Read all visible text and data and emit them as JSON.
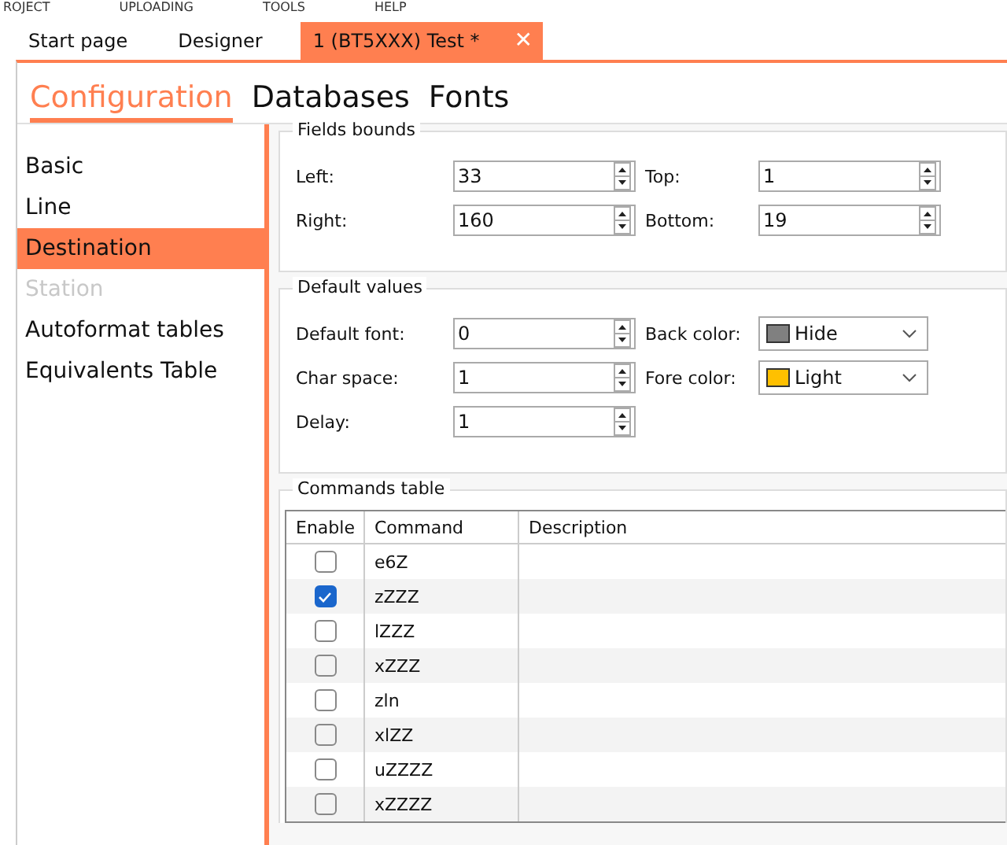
{
  "menu": [
    "ROJECT",
    "UPLOADING",
    "TOOLS",
    "HELP"
  ],
  "doc_tabs": [
    {
      "label": "Start page",
      "selected": false
    },
    {
      "label": "Designer",
      "selected": false
    },
    {
      "label": "1 (BT5XXX) Test *",
      "selected": true
    }
  ],
  "close_glyph": "✕",
  "sub_tabs": [
    {
      "label": "Configuration",
      "selected": true
    },
    {
      "label": "Databases",
      "selected": false
    },
    {
      "label": "Fonts",
      "selected": false
    }
  ],
  "sidebar": {
    "items": [
      {
        "label": "Basic",
        "selected": false,
        "disabled": false
      },
      {
        "label": "Line",
        "selected": false,
        "disabled": false
      },
      {
        "label": "Destination",
        "selected": true,
        "disabled": false
      },
      {
        "label": "Station",
        "selected": false,
        "disabled": true
      },
      {
        "label": "Autoformat tables",
        "selected": false,
        "disabled": false
      },
      {
        "label": "Equivalents Table",
        "selected": false,
        "disabled": false
      }
    ]
  },
  "fields_bounds": {
    "title": "Fields bounds",
    "rows": [
      [
        {
          "kind": "spin",
          "label": "Left:",
          "value": "33"
        },
        {
          "kind": "spin",
          "label": "Top:",
          "value": "1"
        }
      ],
      [
        {
          "kind": "spin",
          "label": "Right:",
          "value": "160"
        },
        {
          "kind": "spin",
          "label": "Bottom:",
          "value": "19"
        }
      ]
    ]
  },
  "default_values": {
    "title": "Default values",
    "rows": [
      [
        {
          "kind": "spin",
          "label": "Default font:",
          "value": "0"
        },
        {
          "kind": "color",
          "label": "Back color:",
          "value": "Hide",
          "color": "#808080"
        }
      ],
      [
        {
          "kind": "spin",
          "label": "Char space:",
          "value": "1"
        },
        {
          "kind": "color",
          "label": "Fore color:",
          "value": "Light",
          "color": "#ffc000"
        }
      ],
      [
        {
          "kind": "spin",
          "label": "Delay:",
          "value": "1"
        }
      ]
    ]
  },
  "commands_table": {
    "title": "Commands table",
    "columns": [
      "Enable",
      "Command",
      "Description"
    ],
    "rows": [
      {
        "checked": false,
        "command": "e6Z"
      },
      {
        "checked": true,
        "command": "zZZZ"
      },
      {
        "checked": false,
        "command": "lZZZ"
      },
      {
        "checked": false,
        "command": "xZZZ"
      },
      {
        "checked": false,
        "command": "zln"
      },
      {
        "checked": false,
        "command": "xlZZ"
      },
      {
        "checked": false,
        "command": "uZZZZ"
      },
      {
        "checked": false,
        "command": "xZZZZ"
      }
    ]
  }
}
